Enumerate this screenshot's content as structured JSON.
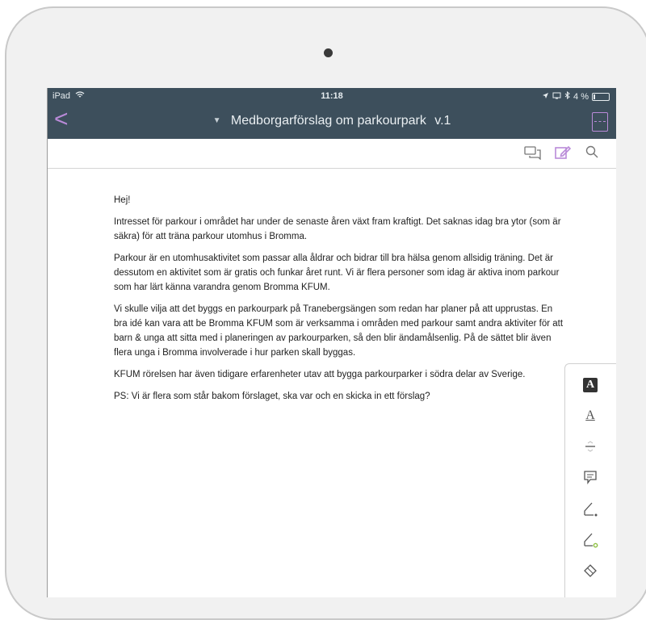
{
  "status": {
    "device": "iPad",
    "time": "11:18",
    "battery": "4 %"
  },
  "nav": {
    "back_label": "<",
    "title": "Medborgarförslag om parkourpark",
    "version": "v.1"
  },
  "toolbar": {
    "icons": [
      "comments-icon",
      "edit-icon",
      "search-icon"
    ]
  },
  "document": {
    "paragraphs": [
      "Hej!",
      "Intresset för parkour i området har under de senaste åren växt fram kraftigt. Det saknas idag bra ytor (som är säkra) för att träna parkour utomhus i Bromma.",
      "Parkour är en utomhusaktivitet som passar alla åldrar och bidrar till bra hälsa genom allsidig träning. Det är dessutom en aktivitet som är gratis och funkar året runt. Vi är flera personer som idag är aktiva inom parkour som har lärt känna varandra genom Bromma KFUM.",
      "Vi skulle vilja att det byggs en parkourpark på Tranebergsängen som redan har planer på att upprustas. En bra idé kan vara att be Bromma KFUM som är verksamma i områden med parkour samt andra aktiviter för att barn & unga att sitta med i planeringen av parkourparken, så den blir ändamålsenlig. På de sättet blir även flera unga i Bromma involverade i hur parken skall byggas.",
      "KFUM rörelsen har även tidigare erfarenheter utav att bygga parkourparker i södra delar av Sverige.",
      "PS: Vi är flera som står bakom förslaget, ska var och en skicka in ett förslag?"
    ]
  },
  "annotation_tools": {
    "highlight_label": "A",
    "underline_label": "A",
    "icons": [
      "highlight-text-icon",
      "underline-text-icon",
      "strikethrough-text-icon",
      "note-icon",
      "freehand-pen-icon",
      "highlighter-pen-icon",
      "eraser-icon"
    ]
  },
  "colors": {
    "navbar": "#3d4f5c",
    "accent": "#b98ad8"
  }
}
